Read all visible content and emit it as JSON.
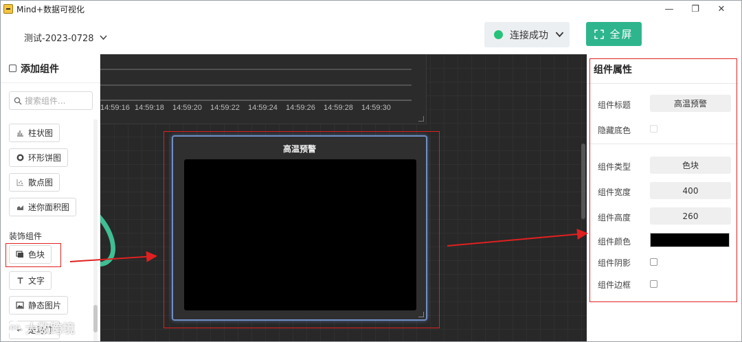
{
  "window": {
    "title": "Mind+数据可视化",
    "controls": [
      "—",
      "❐",
      "✕"
    ]
  },
  "header": {
    "project_name": "测试-2023-0728",
    "connection_label": "连接成功",
    "fullscreen_label": "全屏"
  },
  "left_panel": {
    "title": "添加组件",
    "search_placeholder": "搜索组件...",
    "chart_items": [
      {
        "label": "柱状图",
        "icon": "bar-chart-icon"
      },
      {
        "label": "环形饼图",
        "icon": "donut-chart-icon"
      },
      {
        "label": "散点图",
        "icon": "scatter-chart-icon"
      },
      {
        "label": "迷你面积图",
        "icon": "area-chart-icon"
      }
    ],
    "section_decor": "装饰组件",
    "decor_items": [
      {
        "label": "色块",
        "icon": "color-block-icon"
      },
      {
        "label": "文字",
        "icon": "text-icon"
      },
      {
        "label": "静态图片",
        "icon": "image-icon"
      }
    ],
    "partial_item": "走马灯"
  },
  "canvas": {
    "time_ticks": [
      "14:59:16",
      "14:59:18",
      "14:59:20",
      "14:59:22",
      "14:59:24",
      "14:59:26",
      "14:59:28",
      "14:59:30"
    ],
    "selected_block": {
      "title": "高温预警",
      "color": "#000000"
    }
  },
  "right_panel": {
    "title": "组件属性",
    "props": {
      "title_label": "组件标题",
      "title_value": "高温预警",
      "hide_bg_label": "隐藏底色",
      "type_label": "组件类型",
      "type_value": "色块",
      "width_label": "组件宽度",
      "width_value": "400",
      "height_label": "组件高度",
      "height_value": "260",
      "color_label": "组件颜色",
      "color_value": "#000000",
      "shadow_label": "组件阴影",
      "border_label": "组件边框"
    }
  },
  "watermark": {
    "text": "大数跨境"
  },
  "colors": {
    "accent": "#2fb58e",
    "connected": "#27c27a",
    "annotation": "#e02020",
    "canvas_bg": "#282828"
  }
}
